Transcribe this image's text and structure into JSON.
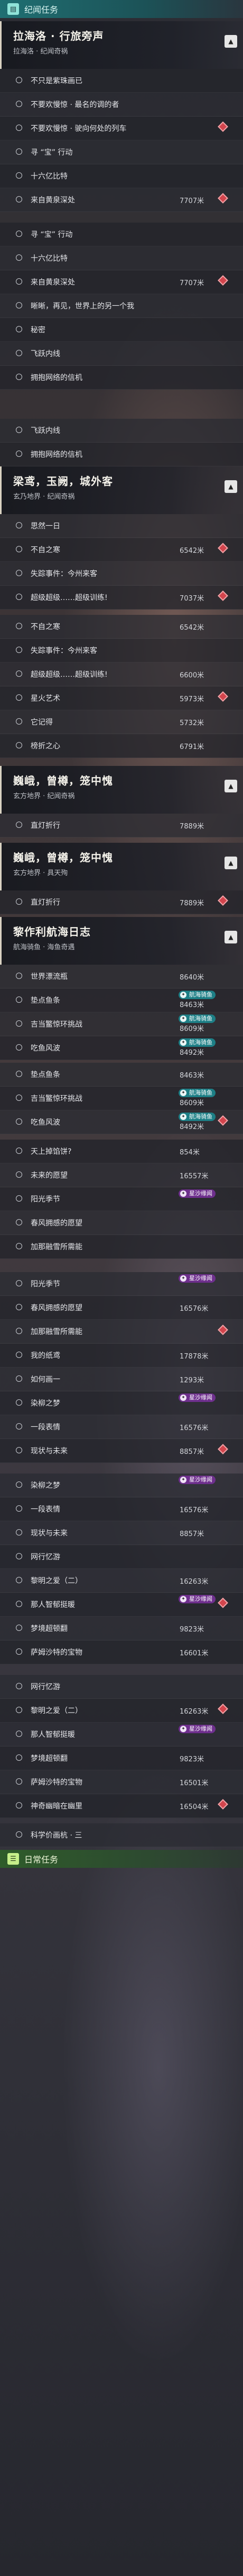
{
  "tabs": {
    "story": {
      "label": "纪闻任务",
      "icon": "book-icon"
    },
    "daily": {
      "label": "日常任务",
      "icon": "calendar-icon"
    }
  },
  "quests": [
    {
      "name": "拉海洛 · 行旅旁声",
      "sub": "拉海洛 · 纪闻奇祸",
      "collapse": "▲"
    },
    {
      "name": "梁鸢，玉阙，城外客",
      "sub": "玄乃地界 · 纪闻奇祸",
      "collapse": "▲"
    },
    {
      "name": "巍峨，曾樽，笼中愧",
      "sub": "玄方地界 · 纪闻奇祸",
      "collapse": "▲"
    },
    {
      "name": "巍峨，曾樽，笼中愧",
      "sub": "玄方地界 · 具天殉",
      "collapse": "▲"
    },
    {
      "name": "黎作利航海日志",
      "sub": "航海骑鱼 · 海鱼奇遇",
      "collapse": "▲"
    }
  ],
  "rows": [
    {
      "label": "不只是紫珠画已",
      "dist": "",
      "badge": ""
    },
    {
      "label": "不要欢慢惊 · 最名的调的者",
      "dist": "",
      "badge": ""
    },
    {
      "label": "不要欢慢惊 · 驶向何处的列车",
      "dist": "",
      "badge": ""
    },
    {
      "label": "寻 “宝” 行动",
      "dist": "",
      "badge": ""
    },
    {
      "label": "十六亿比特",
      "dist": "",
      "badge": ""
    },
    {
      "label": "来自黄泉深处",
      "dist": "7707米",
      "badge": ""
    },
    {
      "label": "寻 “宝” 行动",
      "dist": "",
      "badge": ""
    },
    {
      "label": "十六亿比特",
      "dist": "",
      "badge": ""
    },
    {
      "label": "来自黄泉深处",
      "dist": "7707米",
      "badge": ""
    },
    {
      "label": "晰晰，再见，世界上的另一个我",
      "dist": "",
      "badge": ""
    },
    {
      "label": "秘密",
      "dist": "",
      "badge": ""
    },
    {
      "label": "飞跃内线",
      "dist": "",
      "badge": ""
    },
    {
      "label": "拥抱网络的信机",
      "dist": "",
      "badge": ""
    },
    {
      "label": "飞跃内线",
      "dist": "",
      "badge": ""
    },
    {
      "label": "拥抱网络的信机",
      "dist": "",
      "badge": ""
    },
    {
      "label": "思然一日",
      "dist": "",
      "badge": ""
    },
    {
      "label": "不自之寒",
      "dist": "6542米",
      "badge": ""
    },
    {
      "label": "失踪事件：今州来客",
      "dist": "",
      "badge": ""
    },
    {
      "label": "超级超级……超级训练!",
      "dist": "7037米",
      "badge": ""
    },
    {
      "label": "不自之寒",
      "dist": "6542米",
      "badge": ""
    },
    {
      "label": "失踪事件：今州来客",
      "dist": "",
      "badge": ""
    },
    {
      "label": "超级超级……超级训练!",
      "dist": "6600米",
      "badge": ""
    },
    {
      "label": "星火艺术",
      "dist": "5973米",
      "badge": ""
    },
    {
      "label": "它记得",
      "dist": "5732米",
      "badge": ""
    },
    {
      "label": "榜折之心",
      "dist": "6791米",
      "badge": ""
    },
    {
      "label": "直灯折行",
      "dist": "7889米",
      "badge": ""
    },
    {
      "label": "直灯折行",
      "dist": "7889米",
      "badge": ""
    },
    {
      "label": "世界漂流瓶",
      "dist": "8640米",
      "badge": ""
    },
    {
      "label": "垫点鱼条",
      "dist": "8463米",
      "badge": "航海骑鱼"
    },
    {
      "label": "吉当鳘惊环挑战",
      "dist": "8609米",
      "badge": "航海骑鱼"
    },
    {
      "label": "吃鱼风波",
      "dist": "8492米",
      "badge": "航海骑鱼"
    },
    {
      "label": "垫点鱼条",
      "dist": "8463米",
      "badge": ""
    },
    {
      "label": "吉当鳘惊环挑战",
      "dist": "8609米",
      "badge": "航海骑鱼"
    },
    {
      "label": "吃鱼风波",
      "dist": "8492米",
      "badge": "航海骑鱼"
    },
    {
      "label": "天上掉馅饼?",
      "dist": "854米",
      "badge": ""
    },
    {
      "label": "未来的愿望",
      "dist": "16557米",
      "badge": ""
    },
    {
      "label": "阳光季节",
      "dist": "",
      "badge": "星沙缘闻"
    },
    {
      "label": "春风拥感的愿望",
      "dist": "",
      "badge": ""
    },
    {
      "label": "加那融雪所需能",
      "dist": "",
      "badge": ""
    },
    {
      "label": "阳光季节",
      "dist": "",
      "badge": "星沙缘闻"
    },
    {
      "label": "春风拥感的愿望",
      "dist": "16576米",
      "badge": ""
    },
    {
      "label": "加那融雪所需能",
      "dist": "",
      "badge": ""
    },
    {
      "label": "我的纸鸢",
      "dist": "17878米",
      "badge": ""
    },
    {
      "label": "如何画一",
      "dist": "1293米",
      "badge": ""
    },
    {
      "label": "染柳之梦",
      "dist": "",
      "badge": "星沙缘闻"
    },
    {
      "label": "一段表情",
      "dist": "16576米",
      "badge": ""
    },
    {
      "label": "现状与未来",
      "dist": "8857米",
      "badge": ""
    },
    {
      "label": "染柳之梦",
      "dist": "",
      "badge": "星沙缘闻"
    },
    {
      "label": "一段表情",
      "dist": "16576米",
      "badge": ""
    },
    {
      "label": "现状与未来",
      "dist": "8857米",
      "badge": ""
    },
    {
      "label": "网行忆游",
      "dist": "",
      "badge": ""
    },
    {
      "label": "黎明之爱（二）",
      "dist": "16263米",
      "badge": ""
    },
    {
      "label": "那人智郁挺暖",
      "dist": "",
      "badge": "星沙缘闻"
    },
    {
      "label": "梦境超顿翻",
      "dist": "9823米",
      "badge": ""
    },
    {
      "label": "萨姆沙特的宝物",
      "dist": "16601米",
      "badge": ""
    },
    {
      "label": "网行忆游",
      "dist": "",
      "badge": ""
    },
    {
      "label": "黎明之爱（二）",
      "dist": "16263米",
      "badge": ""
    },
    {
      "label": "那人智郁挺暖",
      "dist": "",
      "badge": "星沙缘闻"
    },
    {
      "label": "梦境超顿翻",
      "dist": "9823米",
      "badge": ""
    },
    {
      "label": "萨姆沙特的宝物",
      "dist": "16501米",
      "badge": ""
    },
    {
      "label": "神奇幽暗在幽里",
      "dist": "16504米",
      "badge": ""
    },
    {
      "label": "科学价画杭 · 三",
      "dist": "",
      "badge": ""
    }
  ],
  "colors": {
    "teal": "#1d7f86",
    "purple": "#6e2f8d",
    "marker": "#d2454d"
  }
}
